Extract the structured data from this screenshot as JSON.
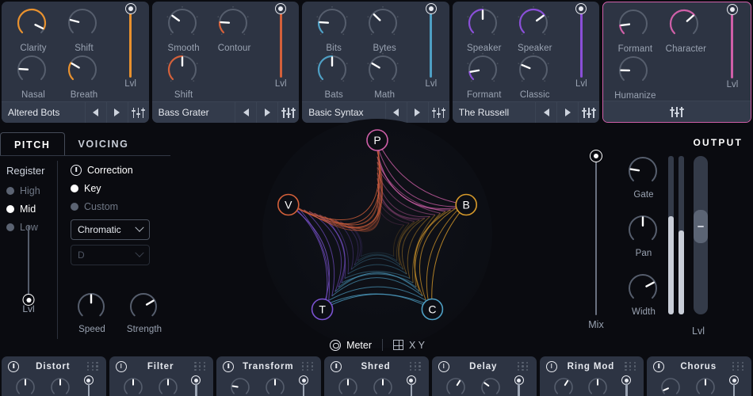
{
  "modules": [
    {
      "preset": "Altered Bots",
      "accent": "#e8912e",
      "selected": false,
      "knobs": [
        {
          "label": "Clarity",
          "value": 0.93,
          "accent": true
        },
        {
          "label": "Shift",
          "value": 0.22,
          "accent": false
        },
        {
          "label": "Nasal",
          "value": 0.18,
          "accent": false
        },
        {
          "label": "Breath",
          "value": 0.28,
          "accent": true
        }
      ],
      "slider": {
        "label": "Lvl",
        "value": 1.0
      }
    },
    {
      "preset": "Bass Grater",
      "accent": "#d4603a",
      "selected": false,
      "knobs": [
        {
          "label": "Smooth",
          "value": 0.3,
          "accent": false
        },
        {
          "label": "Contour",
          "value": 0.18,
          "accent": true
        },
        {
          "label": "Shift",
          "value": 0.5,
          "accent": true
        }
      ],
      "slider": {
        "label": "Lvl",
        "value": 1.0
      }
    },
    {
      "preset": "Basic Syntax",
      "accent": "#4e9fc4",
      "selected": false,
      "knobs": [
        {
          "label": "Bits",
          "value": 0.18,
          "accent": true
        },
        {
          "label": "Bytes",
          "value": 0.33,
          "accent": false
        },
        {
          "label": "Bats",
          "value": 0.5,
          "accent": true
        },
        {
          "label": "Math",
          "value": 0.28,
          "accent": false
        }
      ],
      "slider": {
        "label": "Lvl",
        "value": 1.0
      }
    },
    {
      "preset": "The Russell",
      "accent": "#8a4fd8",
      "selected": false,
      "knobs": [
        {
          "label": "Speaker",
          "value": 0.5,
          "accent": true
        },
        {
          "label": "Speaker",
          "value": 0.7,
          "accent": true
        },
        {
          "label": "Formant",
          "value": 0.13,
          "accent": true
        },
        {
          "label": "Classic",
          "value": 0.25,
          "accent": false
        }
      ],
      "slider": {
        "label": "Lvl",
        "value": 1.0
      }
    },
    {
      "preset": "",
      "accent": "#cf5fa8",
      "selected": true,
      "knobs": [
        {
          "label": "Formant",
          "value": 0.14,
          "accent": true
        },
        {
          "label": "Character",
          "value": 0.68,
          "accent": true
        },
        {
          "label": "Humanize",
          "value": 0.17,
          "accent": false
        }
      ],
      "slider": {
        "label": "Lvl",
        "value": 1.0
      }
    }
  ],
  "pitch_panel": {
    "tabs": [
      {
        "label": "PITCH",
        "active": true
      },
      {
        "label": "VOICING",
        "active": false
      }
    ],
    "register": {
      "title": "Register",
      "options": [
        {
          "label": "High",
          "selected": false
        },
        {
          "label": "Mid",
          "selected": true
        },
        {
          "label": "Low",
          "selected": false
        }
      ]
    },
    "correction": {
      "label": "Correction",
      "enabled": true,
      "options": [
        {
          "label": "Key",
          "selected": true
        },
        {
          "label": "Custom",
          "selected": false
        }
      ],
      "scale_select": {
        "value": "Chromatic",
        "enabled": true
      },
      "root_select": {
        "value": "D",
        "enabled": false
      }
    },
    "level_slider": {
      "label": "Lvl",
      "value": 0.0
    },
    "knobs": [
      {
        "label": "Speed",
        "value": 0.5
      },
      {
        "label": "Strength",
        "value": 0.72
      }
    ]
  },
  "visualizer": {
    "nodes": [
      {
        "label": "P",
        "color": "#cf5fa8",
        "angle": -90
      },
      {
        "label": "B",
        "color": "#d79a2b",
        "angle": -18
      },
      {
        "label": "C",
        "color": "#4e9fc4",
        "angle": 54
      },
      {
        "label": "T",
        "color": "#7a52d0",
        "angle": 126
      },
      {
        "label": "V",
        "color": "#d4603a",
        "angle": 198
      }
    ],
    "view_modes": [
      {
        "label": "Meter",
        "icon": "spiral-icon",
        "active": true
      },
      {
        "label": "X Y",
        "icon": "grid-icon",
        "active": false
      }
    ]
  },
  "output": {
    "title": "OUTPUT",
    "mix_slider": {
      "label": "Mix",
      "value": 1.0
    },
    "knobs": [
      {
        "label": "Gate",
        "value": 0.2
      },
      {
        "label": "Pan",
        "value": 0.5
      },
      {
        "label": "Width",
        "value": 0.73
      }
    ],
    "meters": [
      {
        "level": 0.62
      },
      {
        "level": 0.53
      }
    ],
    "fader": {
      "label": "Lvl",
      "value": 0.57
    }
  },
  "effects": [
    {
      "name": "Distort",
      "enabled": true,
      "knobs": [
        0.5,
        0.5
      ],
      "slider": 1.0
    },
    {
      "name": "Filter",
      "enabled": true,
      "knobs": [
        0.5,
        0.5
      ],
      "slider": 1.0
    },
    {
      "name": "Transform",
      "enabled": true,
      "knobs": [
        0.2,
        0.5
      ],
      "slider": 1.0
    },
    {
      "name": "Shred",
      "enabled": true,
      "knobs": [
        0.5,
        0.5
      ],
      "slider": 1.0
    },
    {
      "name": "Delay",
      "enabled": true,
      "knobs": [
        0.62,
        0.3
      ],
      "slider": 1.0
    },
    {
      "name": "Ring Mod",
      "enabled": true,
      "knobs": [
        0.62,
        0.5
      ],
      "slider": 1.0
    },
    {
      "name": "Chorus",
      "enabled": true,
      "knobs": [
        0.08,
        0.5
      ],
      "slider": 1.0
    }
  ]
}
